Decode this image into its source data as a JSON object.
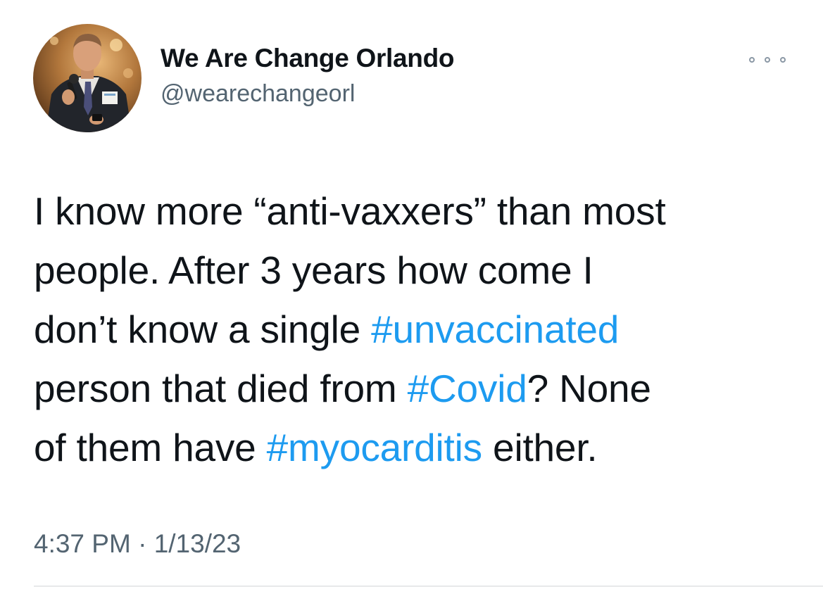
{
  "tweet": {
    "author": {
      "display_name": "We Are Change Orlando",
      "handle": "@wearechangeorl"
    },
    "text_lines": [
      [
        {
          "text": "I know more “anti-vaxxers” than most"
        }
      ],
      [
        {
          "text": "people. After 3 years how come I"
        }
      ],
      [
        {
          "text": "don’t know a single "
        },
        {
          "text": "#unvaccinated",
          "hashtag": true
        }
      ],
      [
        {
          "text": "person that died from "
        },
        {
          "text": "#Covid",
          "hashtag": true
        },
        {
          "text": "? None"
        }
      ],
      [
        {
          "text": "of them have "
        },
        {
          "text": "#myocarditis",
          "hashtag": true
        },
        {
          "text": " either."
        }
      ]
    ],
    "time": "4:37 PM",
    "separator": "·",
    "date": "1/13/23"
  },
  "icons": {
    "more": "more-horizontal-icon",
    "avatar": "profile-photo"
  },
  "colors": {
    "text": "#0f1419",
    "secondary": "#536471",
    "hashtag": "#1d9bf0",
    "background": "#ffffff"
  }
}
